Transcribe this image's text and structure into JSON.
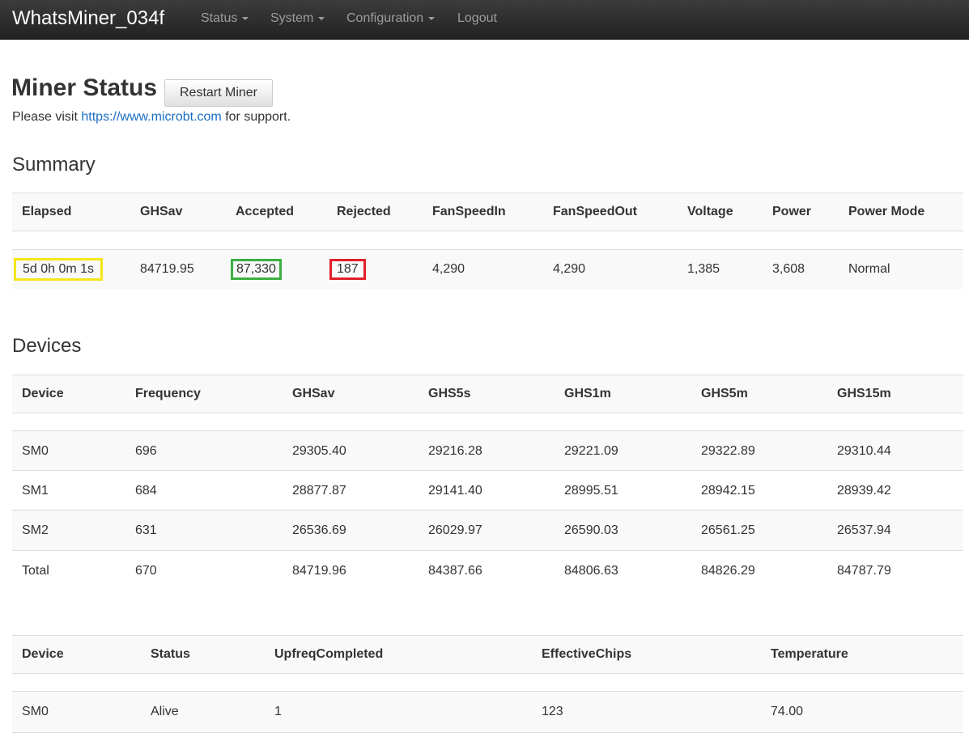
{
  "navbar": {
    "brand": "WhatsMiner_034f",
    "items": [
      {
        "label": "Status",
        "dropdown": true
      },
      {
        "label": "System",
        "dropdown": true
      },
      {
        "label": "Configuration",
        "dropdown": true
      },
      {
        "label": "Logout",
        "dropdown": false
      }
    ]
  },
  "page": {
    "title": "Miner Status",
    "restart_label": "Restart Miner",
    "support_prefix": "Please visit ",
    "support_link": "https://www.microbt.com",
    "support_suffix": " for support."
  },
  "summary": {
    "title": "Summary",
    "headers": [
      "Elapsed",
      "GHSav",
      "Accepted",
      "Rejected",
      "FanSpeedIn",
      "FanSpeedOut",
      "Voltage",
      "Power",
      "Power Mode"
    ],
    "values": [
      "5d 0h 0m 1s",
      "84719.95",
      "87,330",
      "187",
      "4,290",
      "4,290",
      "1,385",
      "3,608",
      "Normal"
    ],
    "highlight_colors": {
      "elapsed": "#f4e61a",
      "accepted": "#3cb043",
      "rejected": "#e0202a"
    }
  },
  "devices": {
    "title": "Devices",
    "headers": [
      "Device",
      "Frequency",
      "GHSav",
      "GHS5s",
      "GHS1m",
      "GHS5m",
      "GHS15m"
    ],
    "rows": [
      [
        "SM0",
        "696",
        "29305.40",
        "29216.28",
        "29221.09",
        "29322.89",
        "29310.44"
      ],
      [
        "SM1",
        "684",
        "28877.87",
        "29141.40",
        "28995.51",
        "28942.15",
        "28939.42"
      ],
      [
        "SM2",
        "631",
        "26536.69",
        "26029.97",
        "26590.03",
        "26561.25",
        "26537.94"
      ],
      [
        "Total",
        "670",
        "84719.96",
        "84387.66",
        "84806.63",
        "84826.29",
        "84787.79"
      ]
    ]
  },
  "device_status": {
    "headers": [
      "Device",
      "Status",
      "UpfreqCompleted",
      "EffectiveChips",
      "Temperature"
    ],
    "rows": [
      [
        "SM0",
        "Alive",
        "1",
        "123",
        "74.00"
      ]
    ]
  }
}
